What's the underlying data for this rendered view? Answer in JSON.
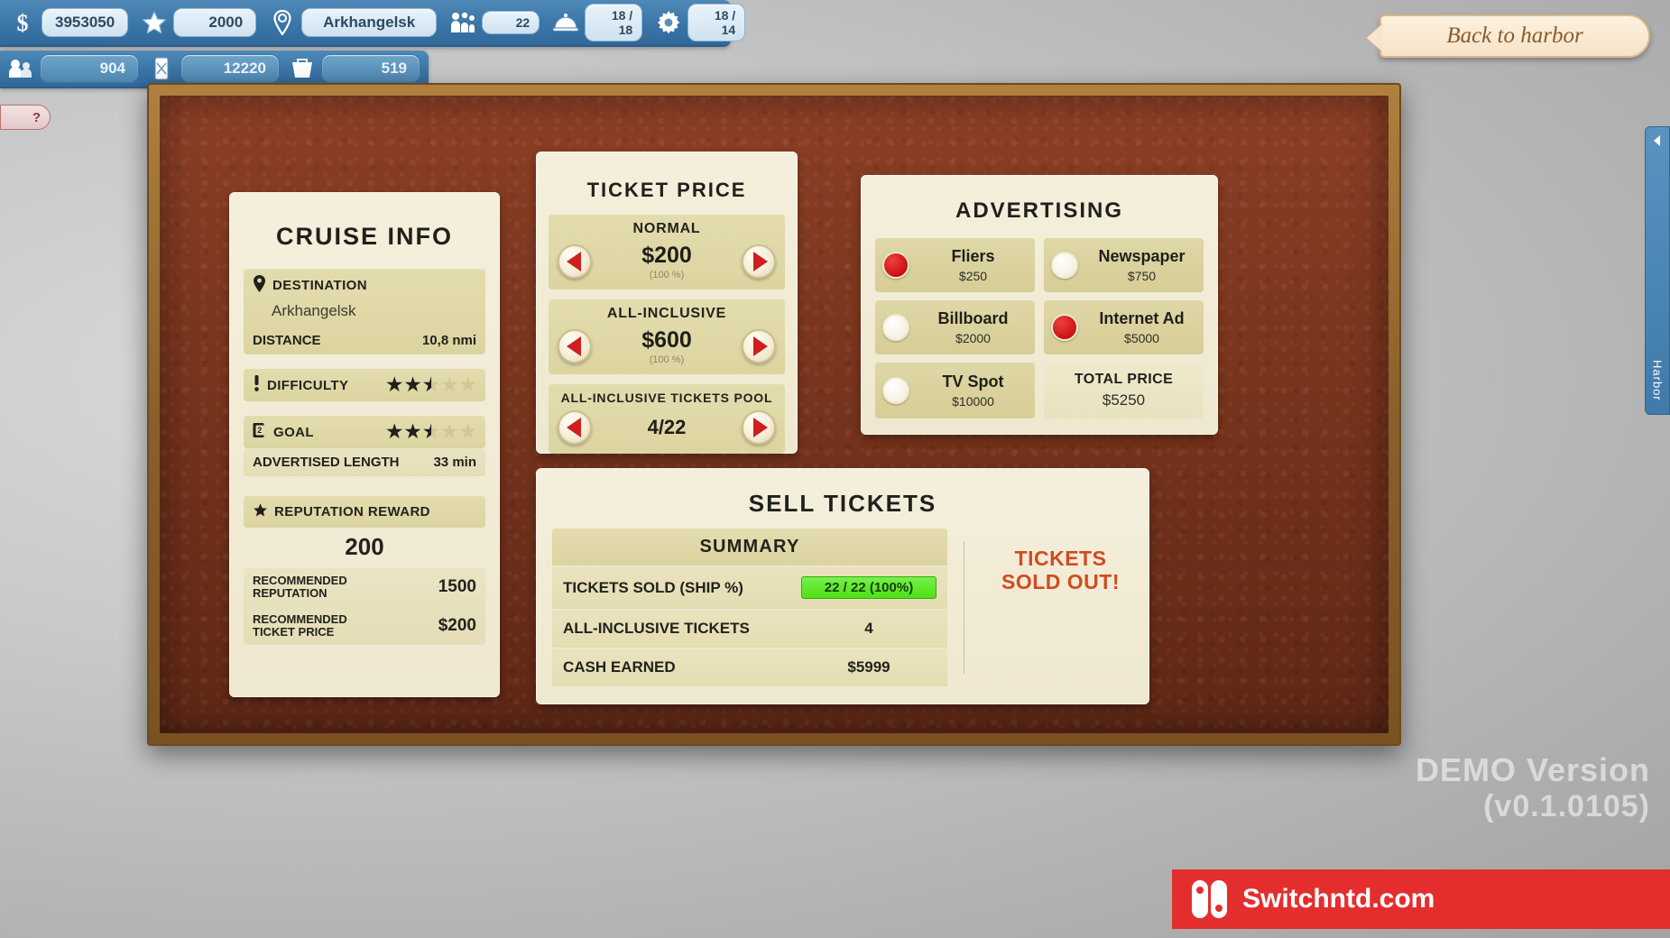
{
  "hud": {
    "row1": [
      {
        "icon": "dollar-icon",
        "value": "3953050",
        "name": "money-stat"
      },
      {
        "icon": "star-icon",
        "value": "2000",
        "name": "reputation-stat"
      },
      {
        "icon": "location-pin-icon",
        "value": "Arkhangelsk",
        "name": "location-stat"
      },
      {
        "icon": "passengers-icon",
        "value": "22",
        "name": "passengers-stat"
      },
      {
        "icon": "food-cloche-icon",
        "value": "18 / 18",
        "name": "food-stat"
      },
      {
        "icon": "gear-icon",
        "value": "18 / 14",
        "name": "crew-stat"
      }
    ],
    "row2": [
      {
        "icon": "crew-icon",
        "value": "904",
        "name": "crew-supply-stat"
      },
      {
        "icon": "fuel-icon",
        "value": "12220",
        "name": "fuel-stat"
      },
      {
        "icon": "basket-icon",
        "value": "519",
        "name": "supplies-stat"
      }
    ],
    "back_to_harbor": "Back to harbor",
    "help_label": "?",
    "right_tab_label": "Harbor"
  },
  "cruise_info": {
    "title": "CRUISE INFO",
    "destination_label": "DESTINATION",
    "destination_value": "Arkhangelsk",
    "distance_label": "DISTANCE",
    "distance_value": "10,8 nmi",
    "difficulty_label": "DIFFICULTY",
    "difficulty_stars": [
      "full",
      "full",
      "half",
      "empty",
      "empty"
    ],
    "goal_label": "GOAL",
    "goal_stars": [
      "full",
      "full",
      "half",
      "empty",
      "empty"
    ],
    "advertised_length_label": "ADVERTISED LENGTH",
    "advertised_length_value": "33 min",
    "reputation_reward_label": "REPUTATION REWARD",
    "reputation_reward_value": "200",
    "recommended_reputation_label": "RECOMMENDED REPUTATION",
    "recommended_reputation_value": "1500",
    "recommended_ticket_price_label": "RECOMMENDED TICKET PRICE",
    "recommended_ticket_price_value": "$200"
  },
  "ticket_price": {
    "title": "TICKET PRICE",
    "normal": {
      "label": "NORMAL",
      "value": "$200",
      "percent": "(100 %)"
    },
    "all_inclusive": {
      "label": "ALL-INCLUSIVE",
      "value": "$600",
      "percent": "(100 %)"
    },
    "pool": {
      "label": "ALL-INCLUSIVE TICKETS POOL",
      "value": "4/22"
    }
  },
  "advertising": {
    "title": "ADVERTISING",
    "options": [
      {
        "name": "Fliers",
        "price": "$250",
        "selected": true
      },
      {
        "name": "Newspaper",
        "price": "$750",
        "selected": false
      },
      {
        "name": "Billboard",
        "price": "$2000",
        "selected": false
      },
      {
        "name": "Internet Ad",
        "price": "$5000",
        "selected": true
      },
      {
        "name": "TV Spot",
        "price": "$10000",
        "selected": false
      }
    ],
    "total_label": "TOTAL PRICE",
    "total_value": "$5250"
  },
  "sell_tickets": {
    "title": "SELL TICKETS",
    "summary_label": "SUMMARY",
    "rows": [
      {
        "label": "TICKETS SOLD (SHIP %)",
        "value": "22 / 22 (100%)",
        "badge": true
      },
      {
        "label": "ALL-INCLUSIVE TICKETS",
        "value": "4",
        "badge": false
      },
      {
        "label": "CASH EARNED",
        "value": "$5999",
        "badge": false
      }
    ],
    "sold_out_line1": "TICKETS",
    "sold_out_line2": "SOLD OUT!"
  },
  "watermark": {
    "line1": "DEMO Version",
    "line2": "(v0.1.0105)",
    "brand": "Switchntd.com"
  },
  "colors": {
    "accent_red": "#d01f1f",
    "sold_out": "#d24b1e",
    "badge_green": "#4fe016",
    "hud_blue": "#3d79aa"
  }
}
